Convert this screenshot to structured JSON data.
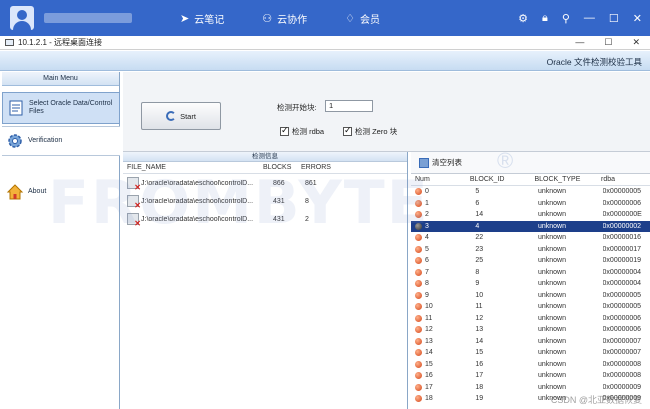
{
  "topbar": {
    "nav": [
      {
        "label": "云笔记",
        "icon": "paper-plane-icon"
      },
      {
        "label": "云协作",
        "icon": "users-icon"
      },
      {
        "label": "会员",
        "icon": "diamond-icon"
      }
    ]
  },
  "remote": {
    "title": "10.1.2.1 - 远程桌面连接",
    "controls": [
      "—",
      "☐",
      "✕"
    ]
  },
  "app": {
    "title": "Oracle 文件检测校验工具"
  },
  "sidebar": {
    "header": "Main Menu",
    "items": [
      {
        "label": "Select Oracle Data/Control Files"
      },
      {
        "label": "Verification"
      },
      {
        "label": "About"
      }
    ]
  },
  "controls": {
    "start_button": "Start",
    "start_block_label": "检测开始块:",
    "start_block_value": "1",
    "check_rdba_label": "检测 rdba",
    "check_zero_label": "检测 Zero 块"
  },
  "info": {
    "header": "检测信息",
    "columns": [
      "FILE_NAME",
      "BLOCKS",
      "ERRORS"
    ],
    "rows": [
      {
        "file": "J:\\oracle\\oradata\\eschool\\controlD...",
        "blocks": "866",
        "errors": "861"
      },
      {
        "file": "J:\\oracle\\oradata\\eschool\\controlD...",
        "blocks": "431",
        "errors": "8"
      },
      {
        "file": "J:\\oracle\\oradata\\eschool\\controlD...",
        "blocks": "431",
        "errors": "2"
      }
    ]
  },
  "blocks": {
    "clear_label": "清空列表",
    "columns": [
      "Num",
      "BLOCK_ID",
      "BLOCK_TYPE",
      "rdba"
    ],
    "rows": [
      {
        "num": "0",
        "id": "5",
        "type": "unknown",
        "rdba": "0x00000005"
      },
      {
        "num": "1",
        "id": "6",
        "type": "unknown",
        "rdba": "0x00000006"
      },
      {
        "num": "2",
        "id": "14",
        "type": "unknown",
        "rdba": "0x0000000E"
      },
      {
        "num": "3",
        "id": "4",
        "type": "unknown",
        "rdba": "0x00000002"
      },
      {
        "num": "4",
        "id": "22",
        "type": "unknown",
        "rdba": "0x00000016"
      },
      {
        "num": "5",
        "id": "23",
        "type": "unknown",
        "rdba": "0x00000017"
      },
      {
        "num": "6",
        "id": "25",
        "type": "unknown",
        "rdba": "0x00000019"
      },
      {
        "num": "7",
        "id": "8",
        "type": "unknown",
        "rdba": "0x00000004"
      },
      {
        "num": "8",
        "id": "9",
        "type": "unknown",
        "rdba": "0x00000004"
      },
      {
        "num": "9",
        "id": "10",
        "type": "unknown",
        "rdba": "0x00000005"
      },
      {
        "num": "10",
        "id": "11",
        "type": "unknown",
        "rdba": "0x00000005"
      },
      {
        "num": "11",
        "id": "12",
        "type": "unknown",
        "rdba": "0x00000006"
      },
      {
        "num": "12",
        "id": "13",
        "type": "unknown",
        "rdba": "0x00000006"
      },
      {
        "num": "13",
        "id": "14",
        "type": "unknown",
        "rdba": "0x00000007"
      },
      {
        "num": "14",
        "id": "15",
        "type": "unknown",
        "rdba": "0x00000007"
      },
      {
        "num": "15",
        "id": "16",
        "type": "unknown",
        "rdba": "0x00000008"
      },
      {
        "num": "16",
        "id": "17",
        "type": "unknown",
        "rdba": "0x00000008"
      },
      {
        "num": "17",
        "id": "18",
        "type": "unknown",
        "rdba": "0x00000009"
      },
      {
        "num": "18",
        "id": "19",
        "type": "unknown",
        "rdba": "0x00000009"
      }
    ],
    "selected_index": 3
  },
  "watermark": {
    "text": "FROMBYTE",
    "credit": "CSDN @北亚数据恢复"
  },
  "colors": {
    "topbar": "#3567c9",
    "selected_row": "#1d3f8a",
    "error_dot": "#d4471a"
  }
}
